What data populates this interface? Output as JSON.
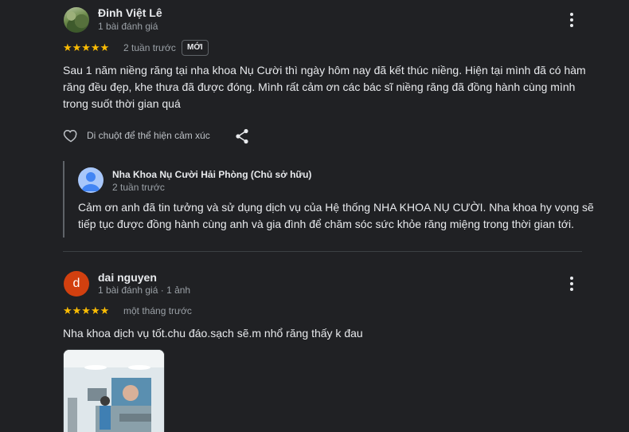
{
  "reviews": [
    {
      "author": "Đinh Việt Lê",
      "meta": "1 bài đánh giá",
      "stars": "★★★★★",
      "rating": 5,
      "time": "2 tuần trước",
      "badge": "MỚI",
      "text_lines": [
        "Sau 1 năm niềng răng tại nha khoa Nụ Cười thì ngày hôm nay đã kết thúc niềng. Hiện tại mình đã có hàm",
        "răng đều đẹp, khe thưa đã được đóng. Mình rất cảm ơn các bác sĩ niềng răng đã đồng hành cùng mình",
        "trong suốt thời gian quá"
      ],
      "like_label": "Di chuột để thể hiện cảm xúc",
      "owner_reply": {
        "name": "Nha Khoa Nụ Cười Hải Phòng (Chủ sở hữu)",
        "time": "2 tuần trước",
        "text_lines": [
          "Cảm ơn anh đã tin tưởng và sử dụng dịch vụ của Hệ thống NHA KHOA NỤ CƯỜI. Nha khoa hy vọng sẽ",
          "tiếp tục được đồng hành cùng anh và gia đình để chăm sóc sức khỏe răng miệng trong thời gian tới."
        ]
      }
    },
    {
      "author": "dai nguyen",
      "avatar_letter": "d",
      "meta": "1 bài đánh giá · 1 ảnh",
      "stars": "★★★★★",
      "rating": 5,
      "time": "một tháng trước",
      "text": "Nha khoa dịch vụ tốt.chu đáo.sạch sẽ.m nhổ răng thấy k đau"
    }
  ],
  "icons": {
    "heart": "heart-outline-icon",
    "share": "share-icon",
    "more": "more-vert-icon"
  },
  "colors": {
    "background": "#202124",
    "star": "#fbbc04",
    "avatar_d": "#d2400f"
  }
}
